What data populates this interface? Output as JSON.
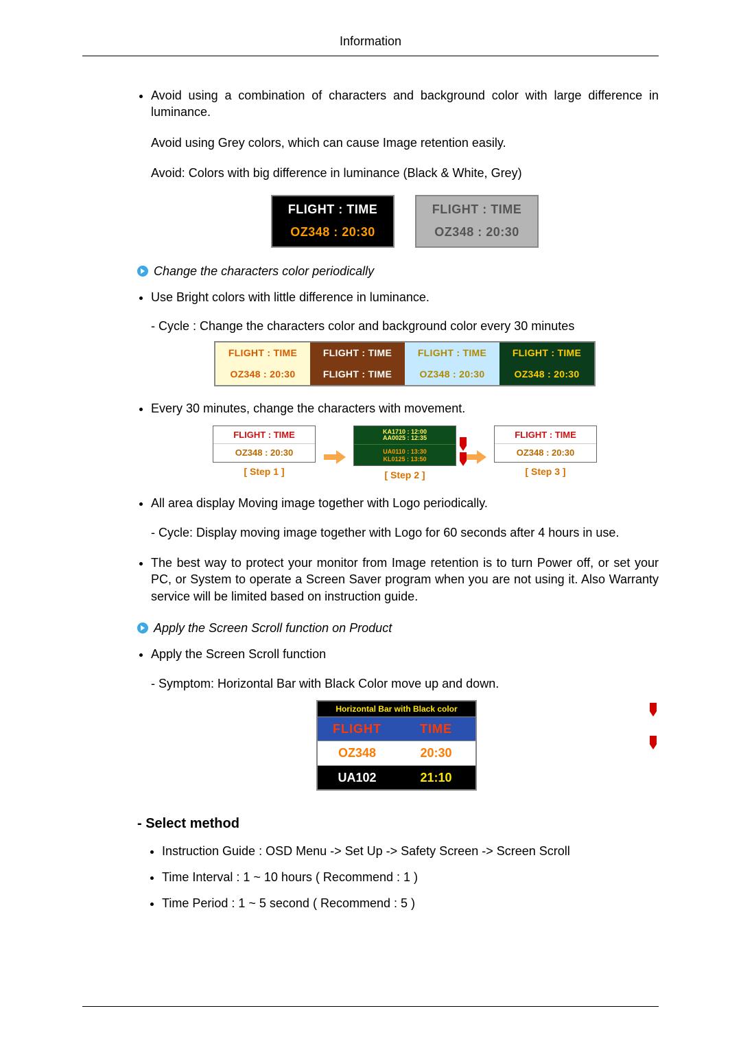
{
  "header": {
    "title": "Information"
  },
  "avoid": {
    "para1": "Avoid using a combination of characters and background color with large difference in luminance.",
    "para2": "Avoid using Grey colors, which can cause Image retention easily.",
    "para3": "Avoid: Colors with big difference in luminance (Black & White, Grey)"
  },
  "example1": {
    "box1": {
      "line1": "FLIGHT  :  TIME",
      "line2": "OZ348    :  20:30"
    },
    "box2": {
      "line1": "FLIGHT  :  TIME",
      "line2": "OZ348    :  20:30"
    }
  },
  "sect_change": {
    "heading": "Change the characters color periodically",
    "bullet1": "Use Bright colors with little difference in luminance.",
    "sub1": "- Cycle : Change the characters color and background color every 30 minutes"
  },
  "fourpanel": {
    "p1": {
      "line1": "FLIGHT  :  TIME",
      "line2": "OZ348    :  20:30"
    },
    "p2": {
      "line1": "FLIGHT  :  TIME",
      "line2": "FLIGHT  :  TIME"
    },
    "p3": {
      "line1": "FLIGHT  :  TIME",
      "line2": "OZ348    :  20:30"
    },
    "p4": {
      "line1": "FLIGHT  :  TIME",
      "line2": "OZ348    :  20:30"
    }
  },
  "movement": {
    "bullet": "Every 30 minutes, change the characters with movement.",
    "step1": {
      "line1": "FLIGHT  :  TIME",
      "line2": "OZ348    :  20:30",
      "label": "[  Step 1  ]"
    },
    "step2": {
      "l1a": "KA1710  :  12:00",
      "l1b": "AA0025  :  12:35",
      "l2a": "UA0110  :  13:30",
      "l2b": "KL0125  :  13:50",
      "label": "[  Step 2  ]"
    },
    "step3": {
      "line1": "FLIGHT  :  TIME",
      "line2": "OZ348    :  20:30",
      "label": "[  Step 3  ]"
    }
  },
  "logo": {
    "bullet": "All area display Moving image together with Logo periodically.",
    "sub": "- Cycle: Display moving image together with Logo for 60 seconds after 4 hours in use."
  },
  "best": {
    "bullet": "The best way to protect your monitor from Image retention is to turn Power off, or set your PC, or System to operate a Screen Saver program when you are not using it. Also Warranty service will be limited based on instruction guide."
  },
  "scroll": {
    "heading": "Apply the Screen Scroll function on Product",
    "bullet": "Apply the Screen Scroll function",
    "sub": "- Symptom: Horizontal Bar with Black Color move up and down.",
    "box": {
      "bar": "Horizontal Bar with Black color",
      "r1c1": "FLIGHT",
      "r1c2": "TIME",
      "r2c1": "OZ348",
      "r2c2": "20:30",
      "r3c1": "UA102",
      "r3c2": "21:10"
    }
  },
  "select_method": {
    "title": "- Select method",
    "i1": "Instruction Guide : OSD Menu -> Set Up -> Safety Screen -> Screen Scroll",
    "i2": "Time Interval : 1 ~ 10 hours ( Recommend : 1 )",
    "i3": "Time Period : 1 ~ 5 second ( Recommend : 5 )"
  }
}
